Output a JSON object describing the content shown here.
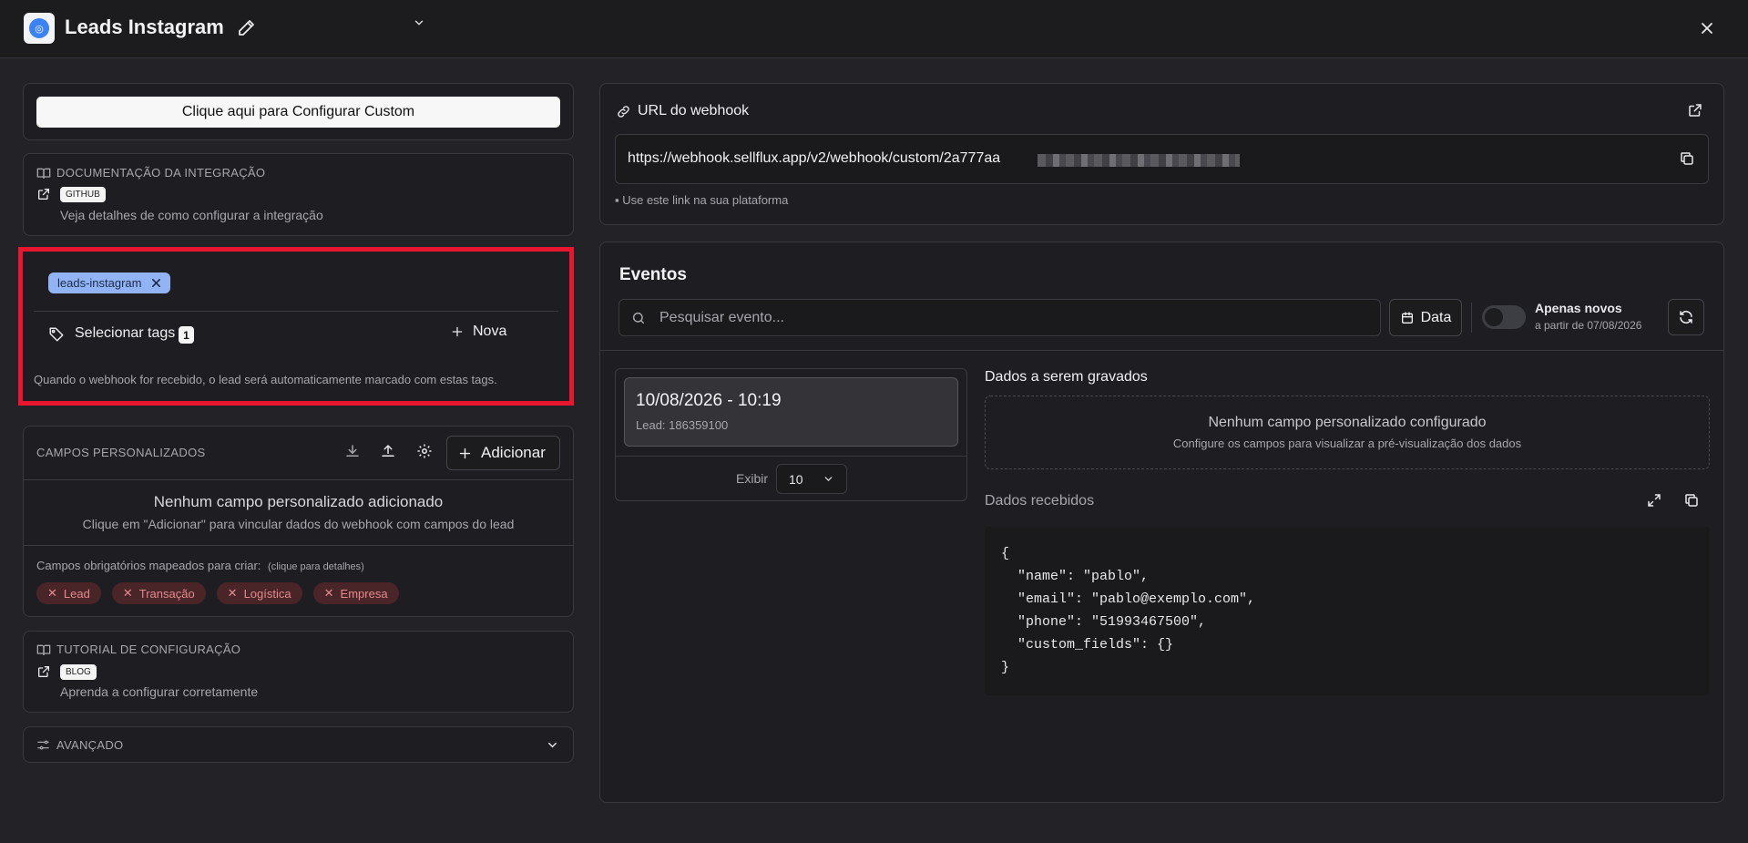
{
  "header": {
    "title": "Leads Instagram"
  },
  "config": {
    "button_label": "Clique aqui para Configurar Custom"
  },
  "documentation": {
    "label": "DOCUMENTAÇÃO DA INTEGRAÇÃO",
    "badge": "GITHUB",
    "description": "Veja detalhes de como configurar a integração"
  },
  "tags": {
    "selected": [
      {
        "label": "leads-instagram"
      }
    ],
    "select_label": "Selecionar tags",
    "count": "1",
    "new_label": "Nova",
    "help": "Quando o webhook for recebido, o lead será automaticamente marcado com estas tags."
  },
  "custom_fields": {
    "label": "CAMPOS PERSONALIZADOS",
    "add_label": "Adicionar",
    "empty_title": "Nenhum campo personalizado adicionado",
    "empty_desc": "Clique em \"Adicionar\" para vincular dados do webhook com campos do lead",
    "required_label": "Campos obrigatórios mapeados para criar:",
    "required_hint": "(clique para detalhes)",
    "required": [
      {
        "label": "Lead"
      },
      {
        "label": "Transação"
      },
      {
        "label": "Logística"
      },
      {
        "label": "Empresa"
      }
    ]
  },
  "tutorial": {
    "label": "TUTORIAL DE CONFIGURAÇÃO",
    "badge": "BLOG",
    "description": "Aprenda a configurar corretamente"
  },
  "advanced": {
    "label": "AVANÇADO"
  },
  "webhook": {
    "title": "URL do webhook",
    "url": "https://webhook.sellflux.app/v2/webhook/custom/2a777aa",
    "hint": "▪ Use este link na sua plataforma"
  },
  "events": {
    "title": "Eventos",
    "search_placeholder": "Pesquisar evento...",
    "date_label": "Data",
    "only_new_label": "Apenas novos",
    "only_new_sub": "a partir de 07/08/2026",
    "items": [
      {
        "datetime": "10/08/2026 - 10:19",
        "lead": "Lead: 186359100"
      }
    ],
    "show_label": "Exibir",
    "page_size": "10"
  },
  "data_to_save": {
    "title": "Dados a serem gravados",
    "empty_title": "Nenhum campo personalizado configurado",
    "empty_desc": "Configure os campos para visualizar a pré-visualização dos dados"
  },
  "data_received": {
    "title": "Dados recebidos",
    "json": "{\n  \"name\": \"pablo\",\n  \"email\": \"pablo@exemplo.com\",\n  \"phone\": \"51993467500\",\n  \"custom_fields\": {}\n}"
  }
}
